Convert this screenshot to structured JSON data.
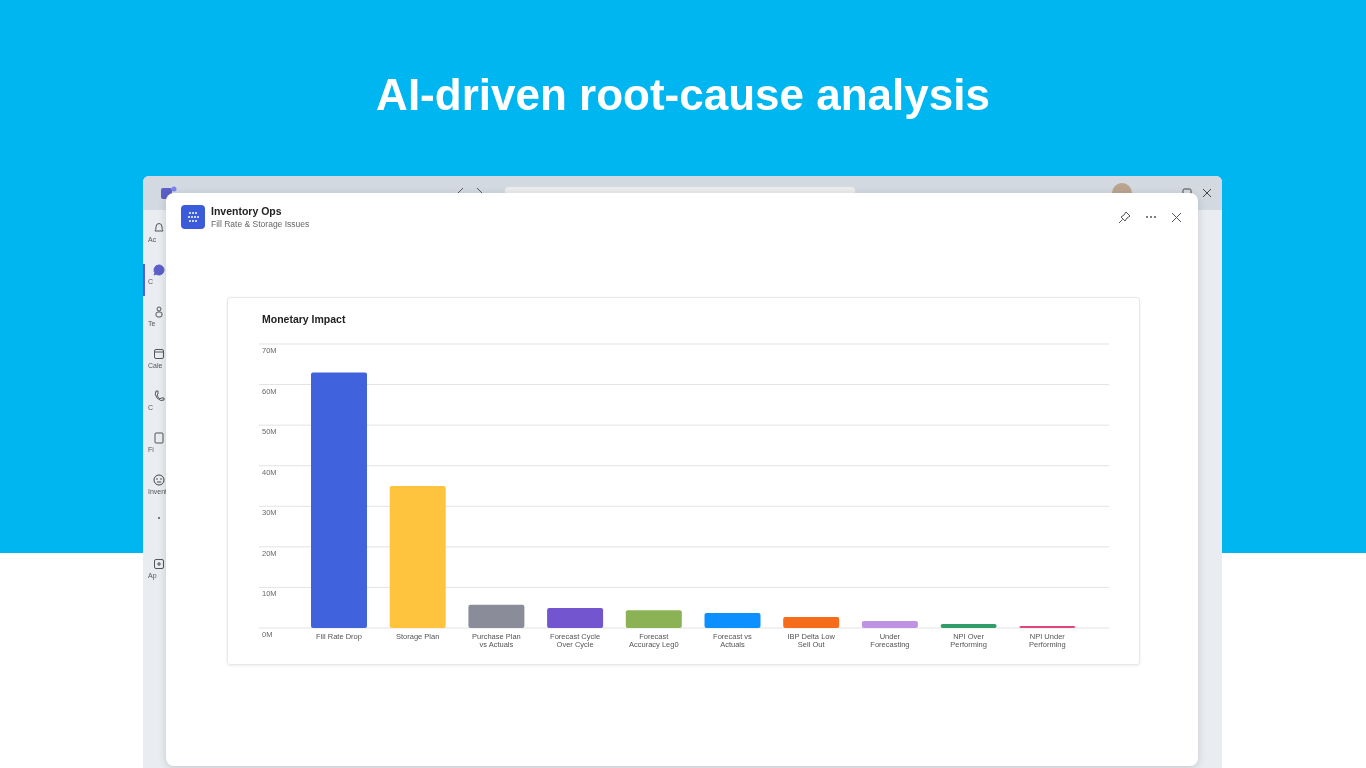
{
  "headline": "AI-driven root-cause analysis",
  "sidebar": {
    "items": [
      {
        "label": "Ac",
        "selected": false
      },
      {
        "label": "C",
        "selected": true
      },
      {
        "label": "Te",
        "selected": false
      },
      {
        "label": "Cale",
        "selected": false
      },
      {
        "label": "C",
        "selected": false
      },
      {
        "label": "Fi",
        "selected": false
      },
      {
        "label": "Invent",
        "selected": false
      },
      {
        "selected": false
      },
      {
        "label": "Ap",
        "selected": false
      }
    ]
  },
  "dialog": {
    "title": "Inventory Ops",
    "subtitle": "Fill Rate & Storage Issues",
    "chart": {
      "chart_data": {
        "type": "bar",
        "title": "Monetary Impact",
        "categories": [
          [
            "Fill Rate Drop"
          ],
          [
            "Storage Plan"
          ],
          [
            "Purchase Plan",
            "vs Actuals"
          ],
          [
            "Forecast Cycle",
            "Over Cycle"
          ],
          [
            "Forecast",
            "Accuracy Leg0"
          ],
          [
            "Forecast vs",
            "Actuals"
          ],
          [
            "IBP Delta Low",
            "Sell Out"
          ],
          [
            "Under",
            "Forecasting"
          ],
          [
            "NPI Over",
            "Performing"
          ],
          [
            "NPI Under",
            "Performing"
          ]
        ],
        "series": [
          {
            "values": [
              63,
              35,
              5.7,
              4.9,
              4.4,
              3.7,
              2.7,
              1.7,
              1.0,
              0.5
            ]
          }
        ],
        "colors": [
          "#4062dc",
          "#ffc43d",
          "#8a8d99",
          "#7356cf",
          "#8bb356",
          "#0c8fff",
          "#f56d1a",
          "#be93e4",
          "#2f9e68",
          "#e2447c"
        ],
        "ylim": [
          0,
          70
        ],
        "grid": true,
        "yticks": [
          {
            "value": 0,
            "label": "0M"
          },
          {
            "value": 10,
            "label": "10M"
          },
          {
            "value": 20,
            "label": "20M"
          },
          {
            "value": 30,
            "label": "30M"
          },
          {
            "value": 40,
            "label": "40M"
          },
          {
            "value": 50,
            "label": "50M"
          },
          {
            "value": 60,
            "label": "60M"
          },
          {
            "value": 70,
            "label": "70M"
          }
        ]
      }
    }
  }
}
